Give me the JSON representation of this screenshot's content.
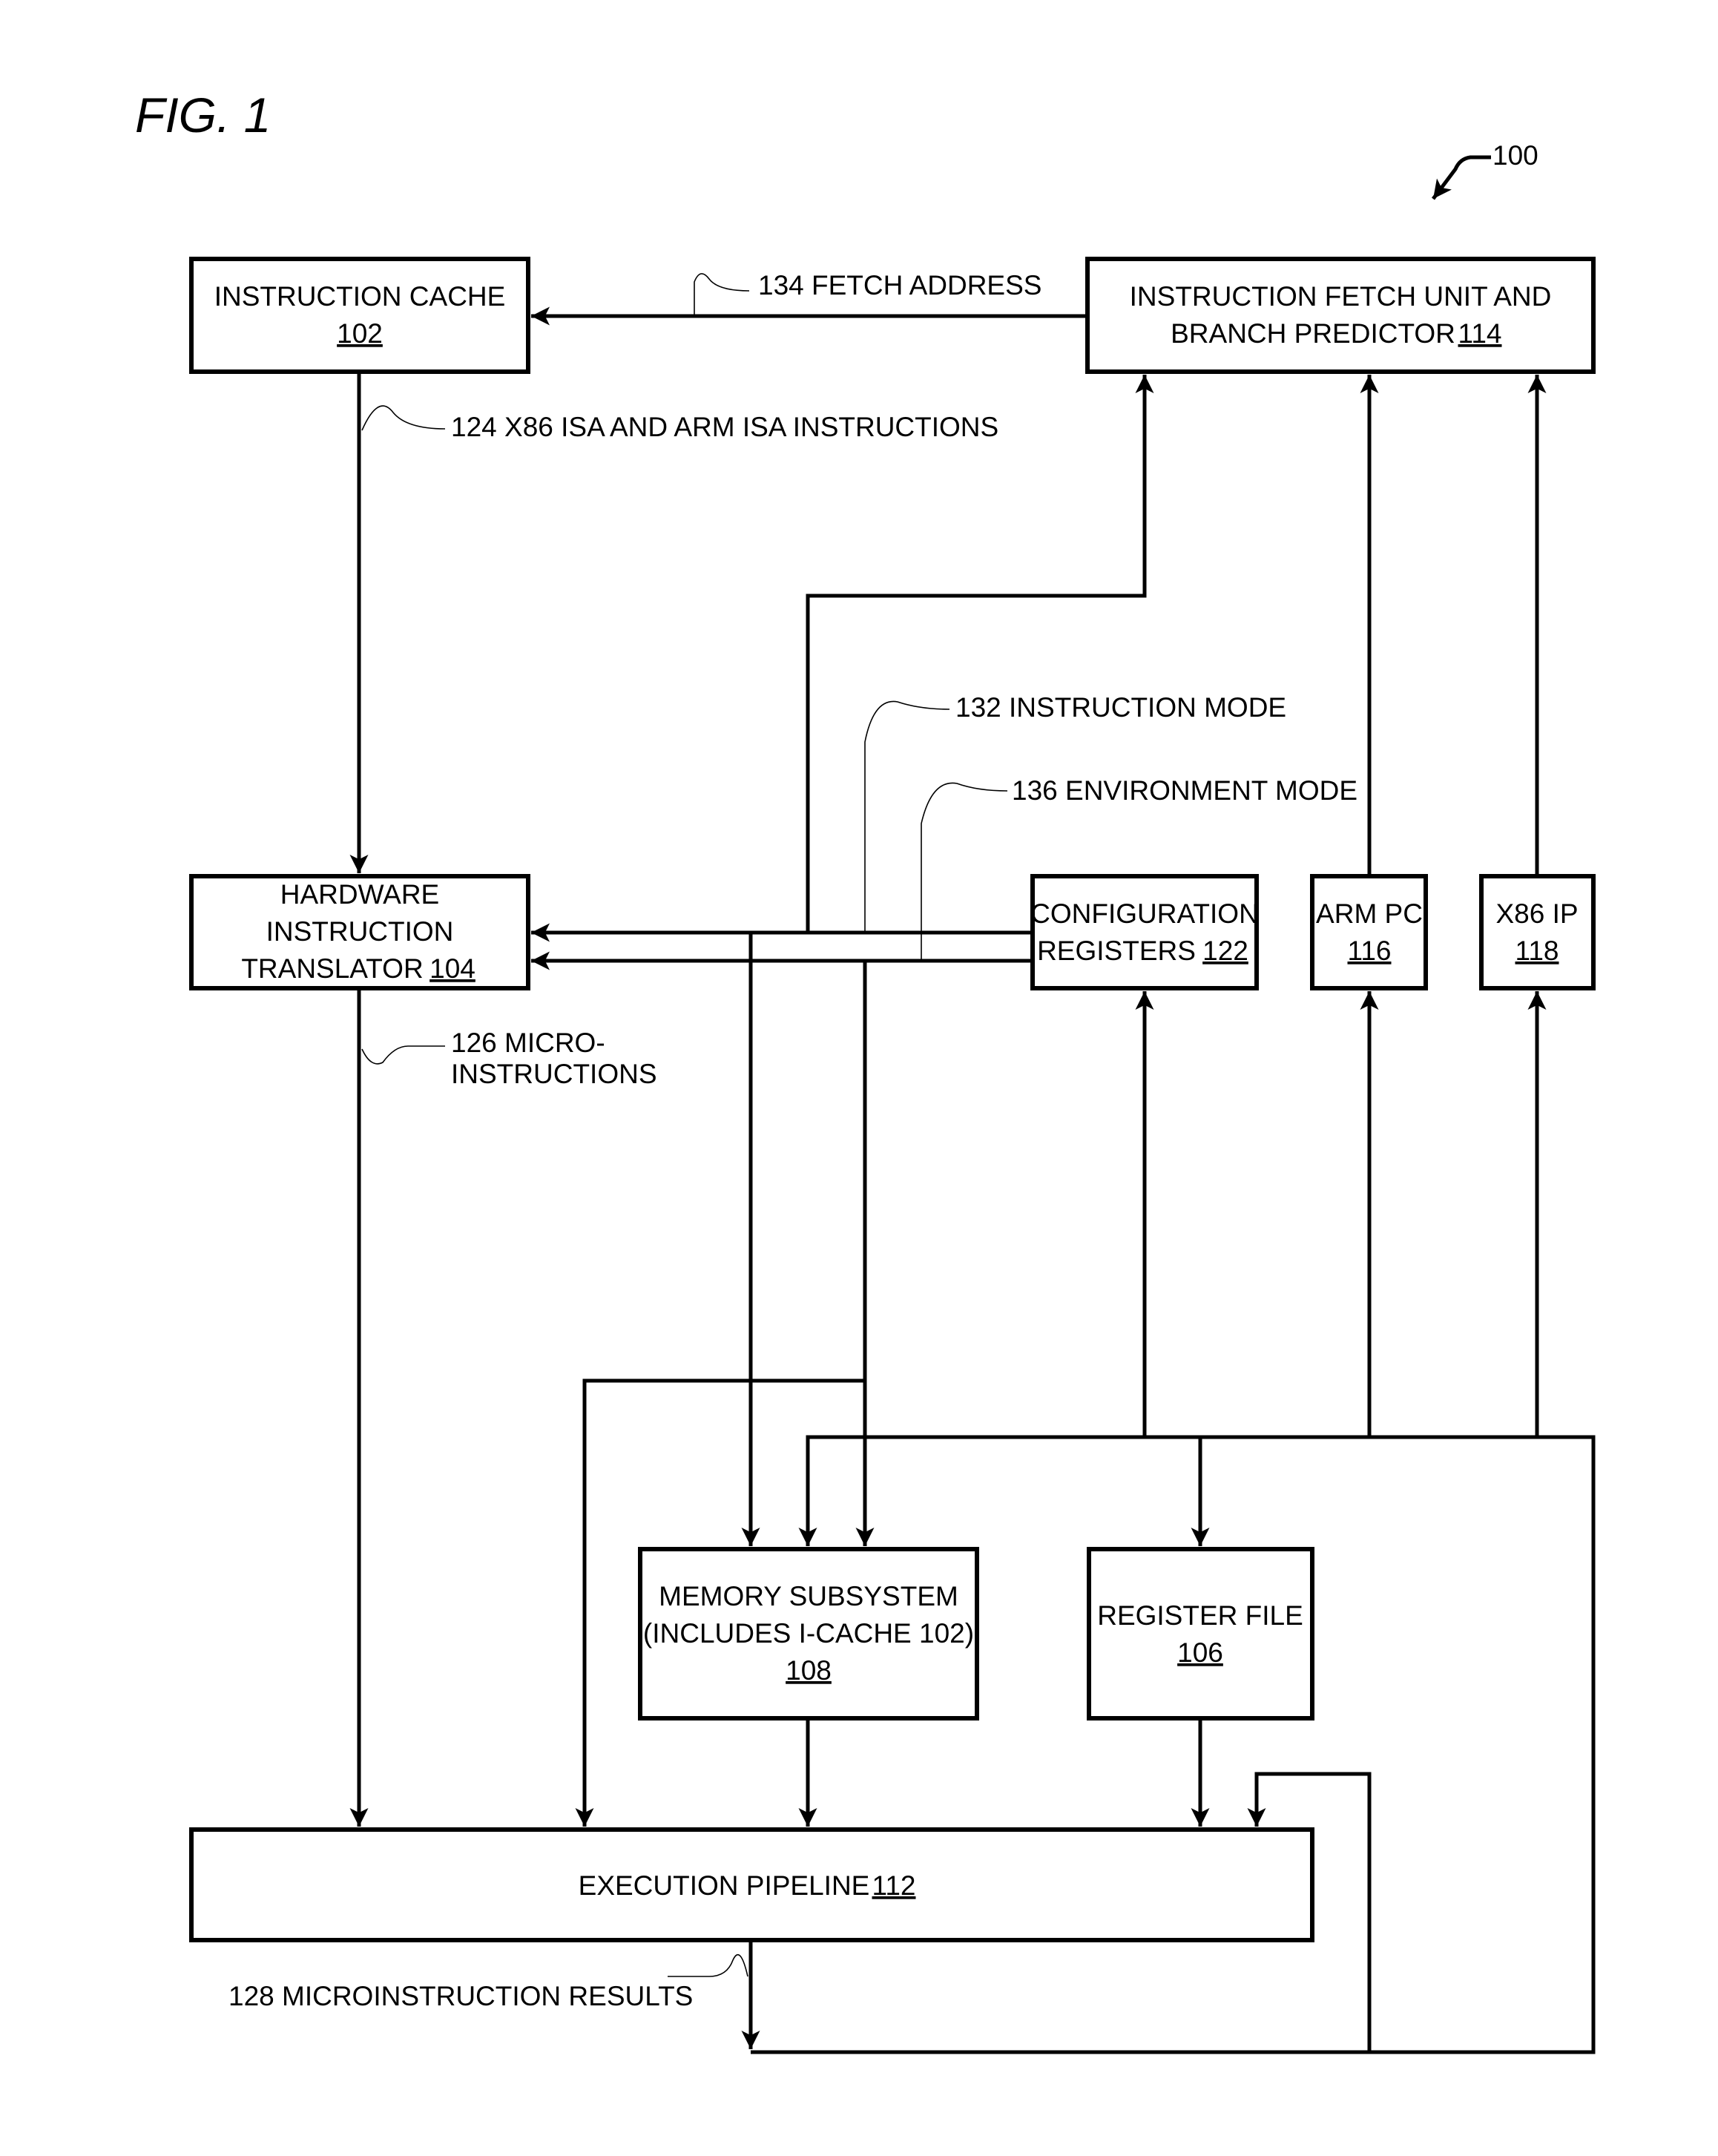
{
  "figure": {
    "title": "FIG. 1",
    "reference": "100"
  },
  "blocks": {
    "instruction_cache": {
      "lines": [
        "INSTRUCTION CACHE"
      ],
      "ref": "102"
    },
    "fetch_unit": {
      "lines": [
        "INSTRUCTION FETCH UNIT AND",
        "BRANCH PREDICTOR"
      ],
      "ref": "114"
    },
    "hw_translator": {
      "lines": [
        "HARDWARE",
        "INSTRUCTION",
        "TRANSLATOR"
      ],
      "ref": "104"
    },
    "config_registers": {
      "lines": [
        "CONFIGURATION",
        "REGISTERS"
      ],
      "ref": "122"
    },
    "arm_pc": {
      "lines": [
        "ARM PC"
      ],
      "ref": "116"
    },
    "x86_ip": {
      "lines": [
        "X86 IP"
      ],
      "ref": "118"
    },
    "memory_subsystem": {
      "lines": [
        "MEMORY SUBSYSTEM",
        "(INCLUDES I-CACHE 102)"
      ],
      "ref": "108"
    },
    "register_file": {
      "lines": [
        "REGISTER FILE"
      ],
      "ref": "106"
    },
    "execution_pipeline": {
      "lines": [
        "EXECUTION PIPELINE"
      ],
      "ref": "112"
    }
  },
  "signals": {
    "fetch_address": "134 FETCH ADDRESS",
    "isa_instructions": "124 X86 ISA AND ARM ISA INSTRUCTIONS",
    "instruction_mode": "132 INSTRUCTION MODE",
    "environment_mode": "136 ENVIRONMENT MODE",
    "micro_instructions": [
      "126 MICRO-",
      "INSTRUCTIONS"
    ],
    "results": "128 MICROINSTRUCTION RESULTS"
  }
}
